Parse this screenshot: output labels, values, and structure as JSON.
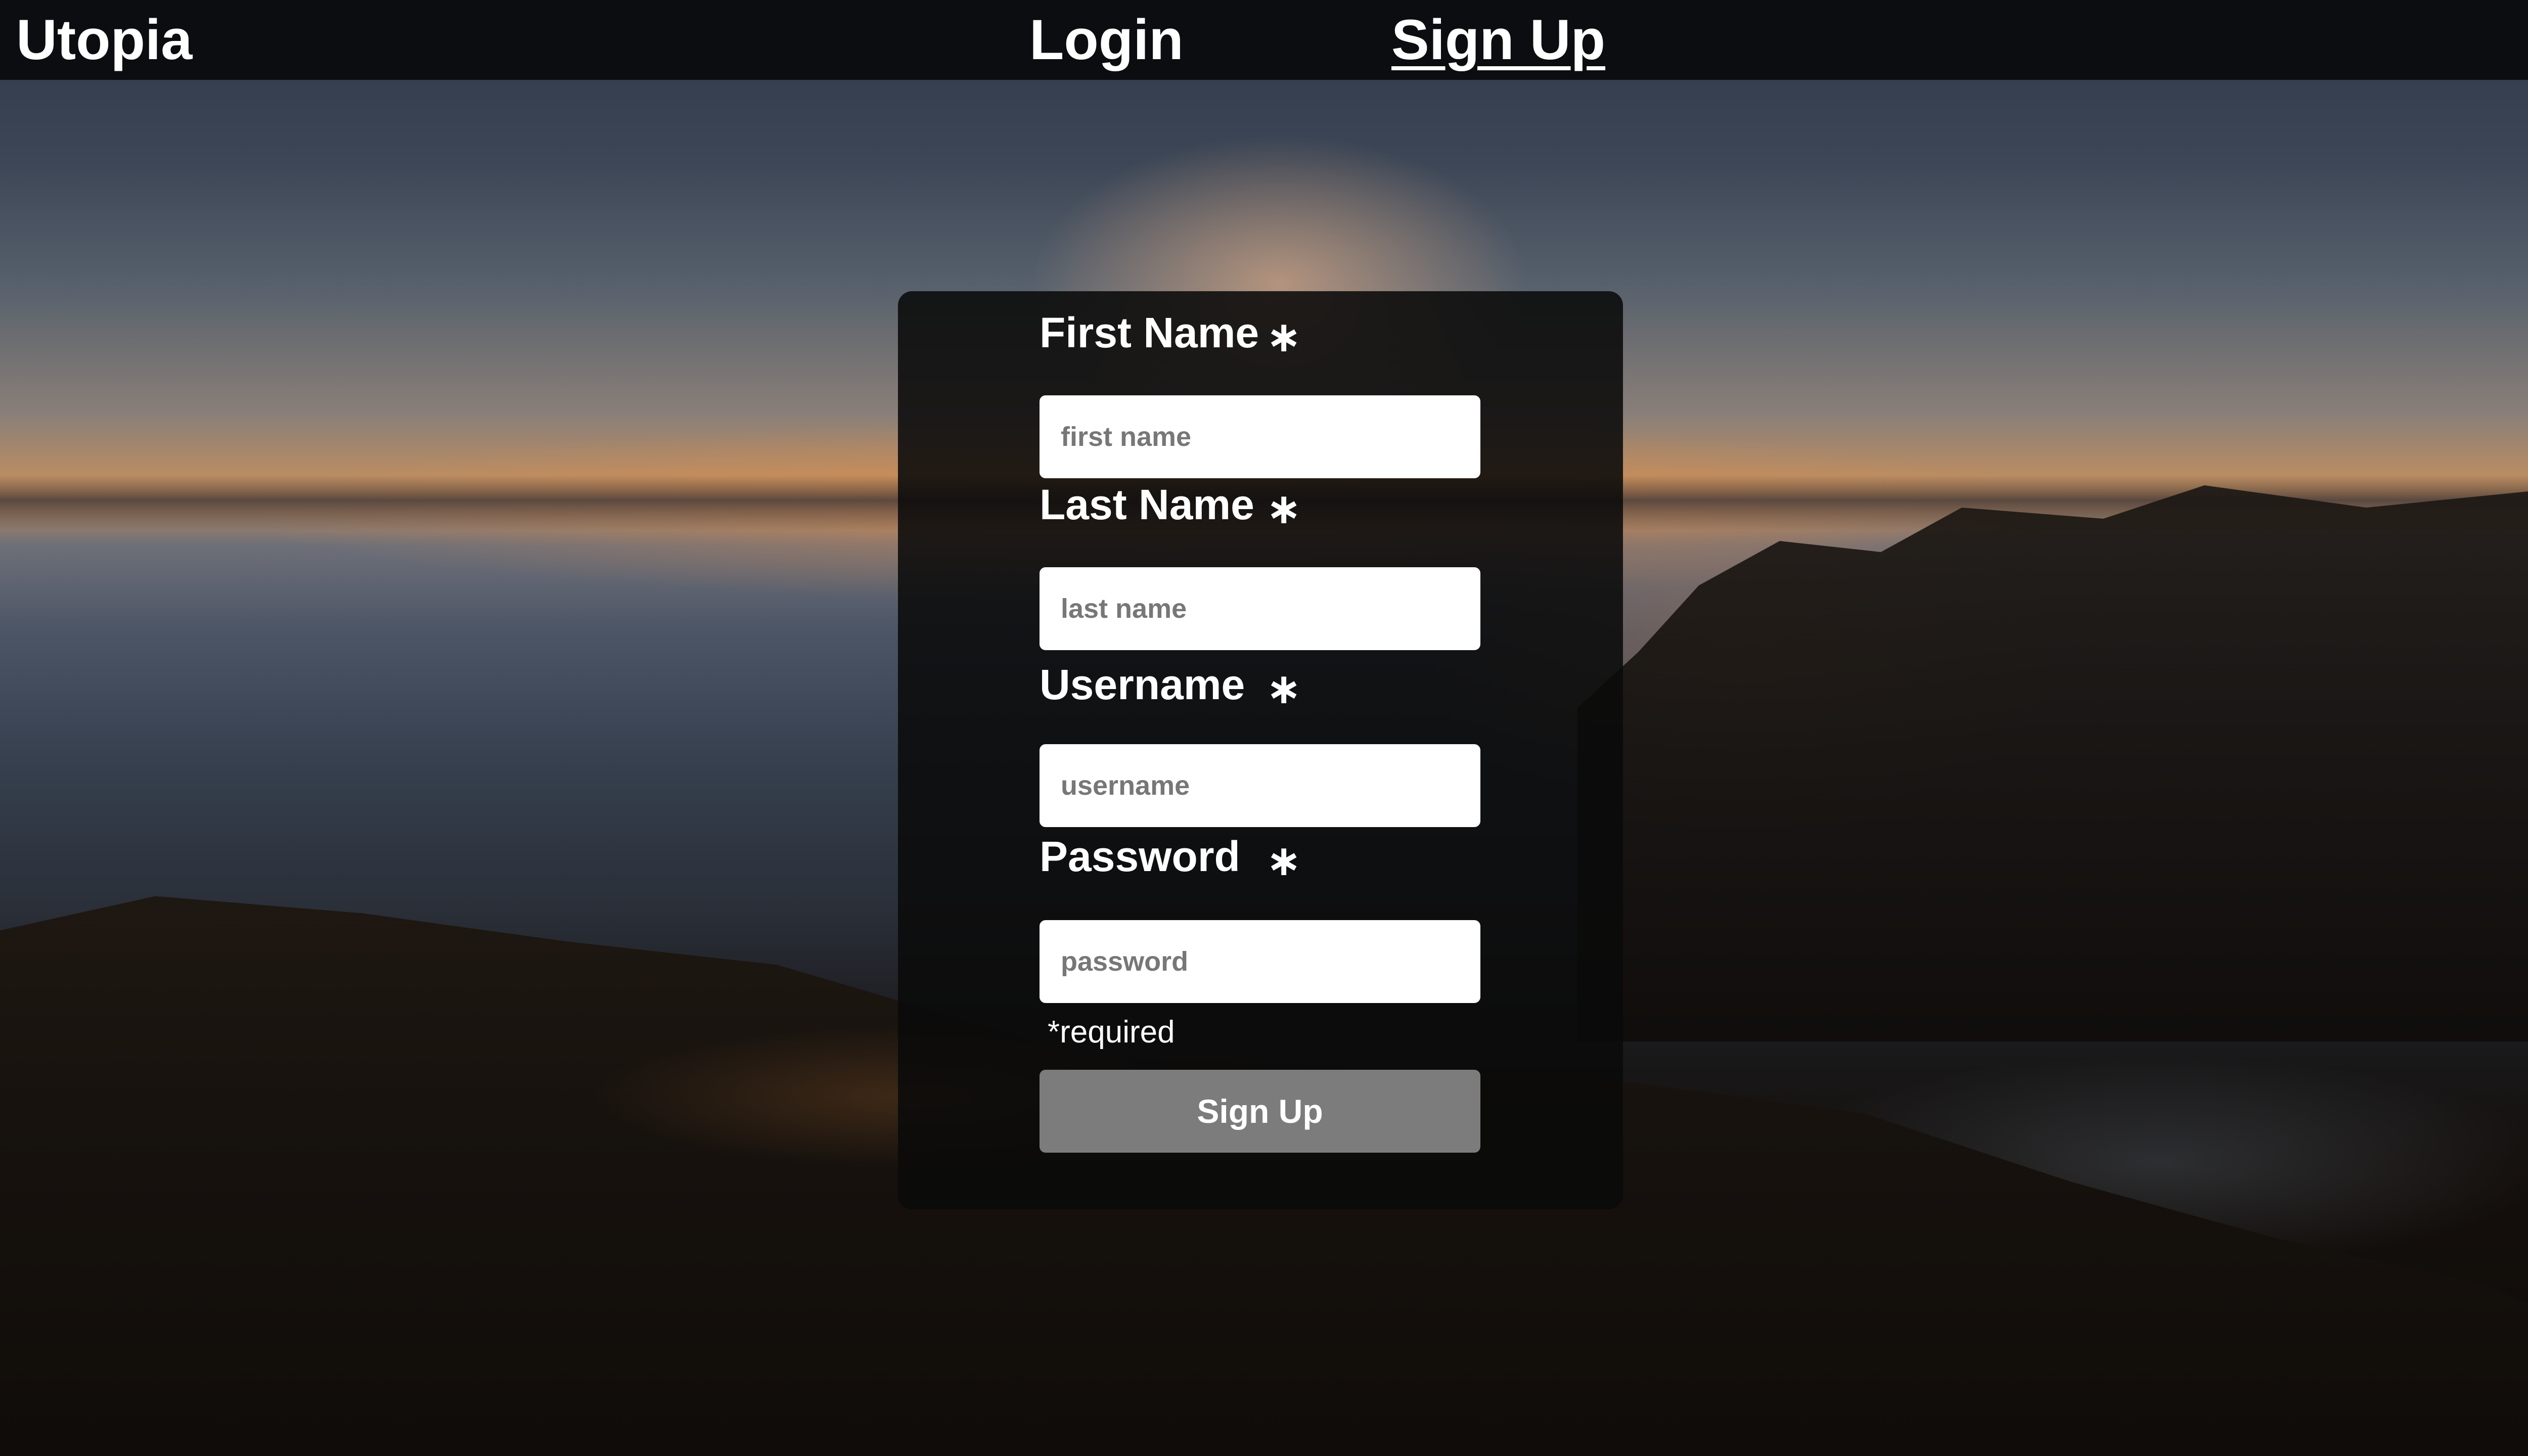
{
  "nav": {
    "brand": "Utopia",
    "links": [
      {
        "label": "Login",
        "active": false
      },
      {
        "label": "Sign Up",
        "active": true
      }
    ]
  },
  "signup_form": {
    "fields": [
      {
        "label": "First Name",
        "required_marker": "∗",
        "placeholder": "first name",
        "value": ""
      },
      {
        "label": "Last Name",
        "required_marker": "∗",
        "placeholder": "last name",
        "value": ""
      },
      {
        "label": "Username",
        "required_marker": "∗",
        "placeholder": "username",
        "value": ""
      },
      {
        "label": "Password",
        "required_marker": "∗",
        "placeholder": "password",
        "value": ""
      }
    ],
    "required_note": "*required",
    "submit_label": "Sign Up"
  },
  "colors": {
    "navbar_bg": "#0b0d10",
    "card_bg": "rgba(10,10,10,0.88)",
    "button_bg": "#7c7c7c",
    "input_bg": "#ffffff"
  },
  "background": {
    "icon": "sunrise-coast-photo"
  }
}
